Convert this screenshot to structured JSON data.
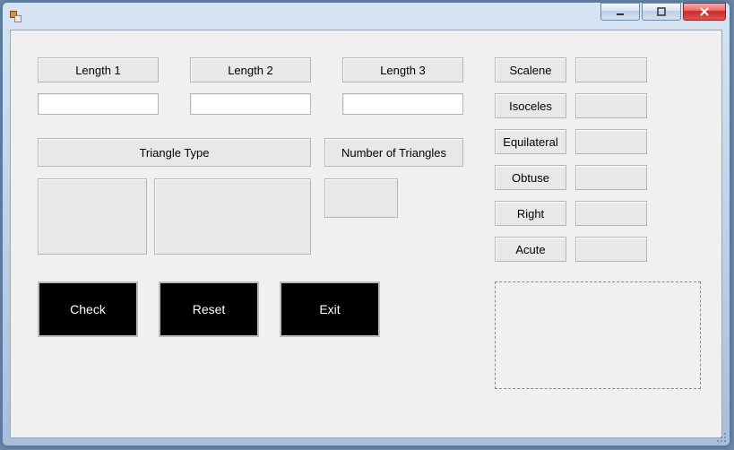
{
  "window": {
    "title": ""
  },
  "labels": {
    "length1": "Length 1",
    "length2": "Length 2",
    "length3": "Length 3",
    "triangle_type": "Triangle Type",
    "num_triangles": "Number of Triangles"
  },
  "inputs": {
    "length1": "",
    "length2": "",
    "length3": ""
  },
  "panels": {
    "triangle_type_out1": "",
    "triangle_type_out2": "",
    "num_triangles_out": ""
  },
  "buttons": {
    "check": "Check",
    "reset": "Reset",
    "exit": "Exit"
  },
  "counts": {
    "scalene": {
      "label": "Scalene",
      "value": ""
    },
    "isoceles": {
      "label": "Isoceles",
      "value": ""
    },
    "equilateral": {
      "label": "Equilateral",
      "value": ""
    },
    "obtuse": {
      "label": "Obtuse",
      "value": ""
    },
    "right": {
      "label": "Right",
      "value": ""
    },
    "acute": {
      "label": "Acute",
      "value": ""
    }
  }
}
